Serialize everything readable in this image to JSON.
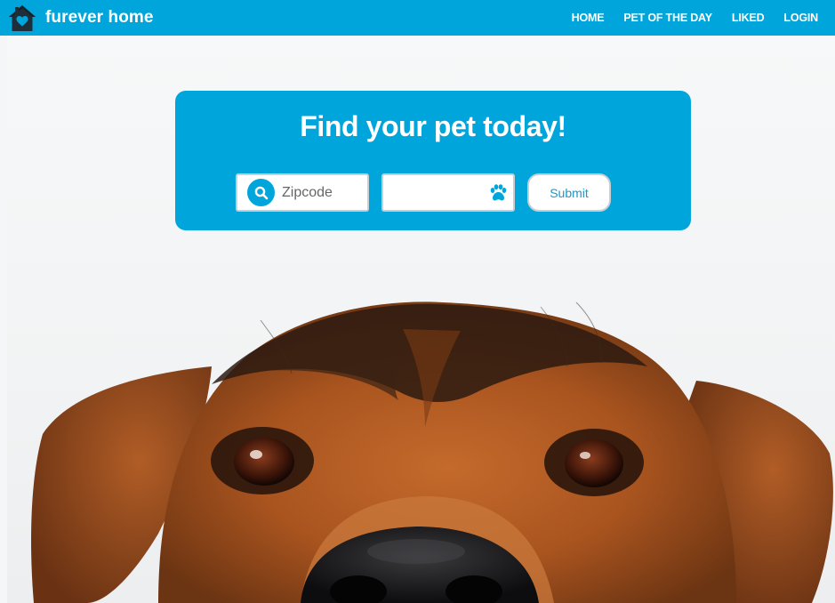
{
  "app": {
    "brand_name": "furever home",
    "logo_icon": "house-heart-icon"
  },
  "nav": {
    "items": [
      {
        "label": "HOME"
      },
      {
        "label": "PET OF THE DAY"
      },
      {
        "label": "LIKED"
      },
      {
        "label": "LOGIN"
      }
    ]
  },
  "search": {
    "title": "Find your pet today!",
    "zipcode_placeholder": "Zipcode",
    "zipcode_value": "",
    "pet_type_value": "",
    "submit_label": "Submit",
    "search_icon": "search-icon",
    "pet_icon": "paw-icon"
  },
  "hero": {
    "image_subject": "dog-peeking-photo"
  },
  "colors": {
    "brand": "#00a6db",
    "accent_text": "#1a97c9",
    "white": "#ffffff",
    "field_border": "#c7cfd4"
  }
}
